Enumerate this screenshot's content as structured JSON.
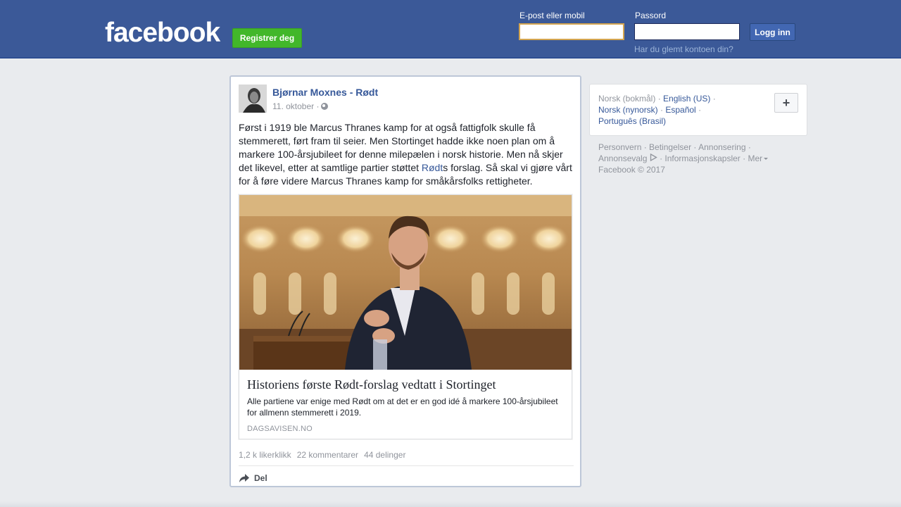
{
  "header": {
    "logo": "facebook",
    "register_label": "Registrer deg",
    "email_label": "E-post eller mobil",
    "password_label": "Passord",
    "login_label": "Logg inn",
    "forgot_label": "Har du glemt kontoen din?",
    "email_value": "",
    "password_value": ""
  },
  "post": {
    "author": "Bjørnar Moxnes - Rødt",
    "date": "11. oktober ·",
    "text_before_link": "Først i 1919 ble Marcus Thranes kamp for at også fattigfolk skulle få stemmerett, ført fram til seier. Men Stortinget hadde ikke noen plan om å markere 100-årsjubileet for denne milepælen i norsk historie. Men nå skjer det likevel, etter at samtlige partier støttet ",
    "text_link": "Rødt",
    "text_after_link": "s forslag. Så skal vi gjøre vårt for å føre videre Marcus Thranes kamp for småkårsfolks rettigheter.",
    "link_preview": {
      "title": "Historiens første Rødt-forslag vedtatt i Stortinget",
      "description": "Alle partiene var enige med Rødt om at det er en god idé å markere 100-årsjubileet for allmenn stemmerett i 2019.",
      "source": "DAGSAVISEN.NO"
    },
    "stats": {
      "likes": "1,2 k likerklikk",
      "comments": "22 kommentarer",
      "shares": "44 delinger"
    },
    "share_label": "Del"
  },
  "sidebar": {
    "languages": {
      "current": "Norsk (bokmål)",
      "english": "English (US)",
      "nynorsk": "Norsk (nynorsk)",
      "spanish": "Español",
      "portuguese": "Português (Brasil)",
      "add_label": "+"
    },
    "footer": {
      "privacy": "Personvern",
      "terms": "Betingelser",
      "advertising": "Annonsering",
      "adchoices": "Annonsevalg",
      "cookies": "Informasjonskapsler",
      "more": "Mer",
      "copyright": "Facebook © 2017"
    }
  },
  "colors": {
    "header_bg": "#3b5998",
    "link": "#365899",
    "register_green": "#42b72a",
    "page_bg": "#e9ebee"
  }
}
